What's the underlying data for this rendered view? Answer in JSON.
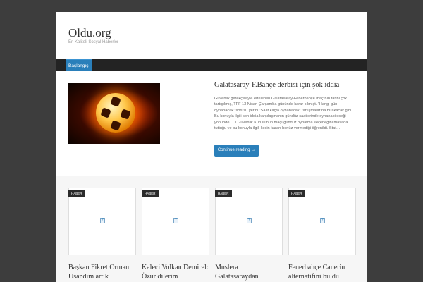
{
  "site": {
    "title": "Oldu.org",
    "tagline": "En Kaliteli Sosyal Haberler"
  },
  "nav": {
    "items": [
      {
        "label": "Başlangıç"
      }
    ]
  },
  "featured": {
    "title": "Galatasaray-F.Bahçe derbisi için şok iddia",
    "excerpt": "Güvenlik gerekçesiyle ertelenen Galatasaray-Fenerbahçe maçının tarihi çok tartışılmış, TFF 13 Nisan Çarşamba gününde karar kılmışt. “Hangi gün oynanacak” sorusu yerini “Saat kaçta oynanacak” tartışmalarına bırakacak gibi. Bu konuyla ilgili son iddia karşılaşmanın gündüz saatlerinde oynanabileceği yönünde… İl Güvenlik Kurulu’nun maçı gündüz oynatma seçeneğini masada tuttuğu ve bu konuyla ilgili kesin kararı henüz vermediği öğrenildi. Stat…",
    "button": "Continue reading →",
    "image_icon": "flaming-football-image"
  },
  "posts": [
    {
      "badge": "HABER",
      "title": "Başkan Fikret Orman: Usandım artık"
    },
    {
      "badge": "HABER",
      "title": "Kaleci Volkan Demirel: Özür dilerim"
    },
    {
      "badge": "HABER",
      "title": "Muslera Galatasaraydan ayrılıyor mu"
    },
    {
      "badge": "HABER",
      "title": "Fenerbahçe Canerin alternatifini buldu"
    }
  ],
  "colors": {
    "background": "#3d3d3d",
    "accent": "#2a7fba",
    "nav": "#232323",
    "badge": "#2b2b2b"
  }
}
